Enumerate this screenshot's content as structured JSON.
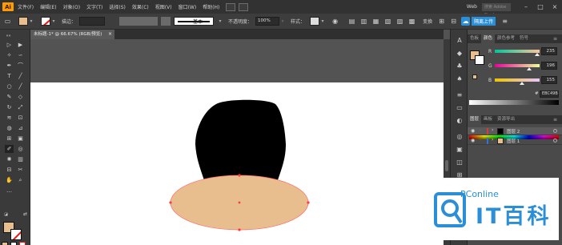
{
  "app": {
    "logo": "Ai"
  },
  "menubar": {
    "items": [
      "文件(F)",
      "编辑(E)",
      "对象(O)",
      "文字(T)",
      "选择(S)",
      "效果(C)",
      "视图(V)",
      "窗口(W)",
      "帮助(H)"
    ],
    "workspace": "Web",
    "search_placeholder": "搜索 Adobe Stock"
  },
  "controlbar": {
    "stroke_label": "描边：",
    "stroke_value": "",
    "stroke_style": "基本",
    "opacity_label": "不透明度：",
    "opacity_value": "100%",
    "style_label": "样式：",
    "transform_label": "变换",
    "sync_button": "隔离上传"
  },
  "document": {
    "tab_title": "未标题-1* @ 66.67% (RGB/预览)",
    "close": "×",
    "colors": {
      "fill": "#e8be8f",
      "hat": "#000000",
      "canvas": "#ffffff"
    }
  },
  "panels": {
    "color_tabs": [
      "色板",
      "颜色",
      "颜色参考",
      "符号"
    ],
    "active_color_tab": "颜色",
    "sliders": [
      {
        "channel": "R",
        "value": "235"
      },
      {
        "channel": "G",
        "value": "196"
      },
      {
        "channel": "B",
        "value": "155"
      }
    ],
    "hex_prefix": "#",
    "hex_value": "EBC49B",
    "layer_tabs": [
      "图层",
      "画板",
      "资源导出"
    ],
    "active_layer_tab": "图层",
    "layers": [
      {
        "name": "图层 2",
        "color": "#d63b3b"
      },
      {
        "name": "图层 1",
        "color": "#3b6fd6"
      }
    ]
  },
  "watermark": {
    "line1": "PConline",
    "line2": "IT百科"
  }
}
